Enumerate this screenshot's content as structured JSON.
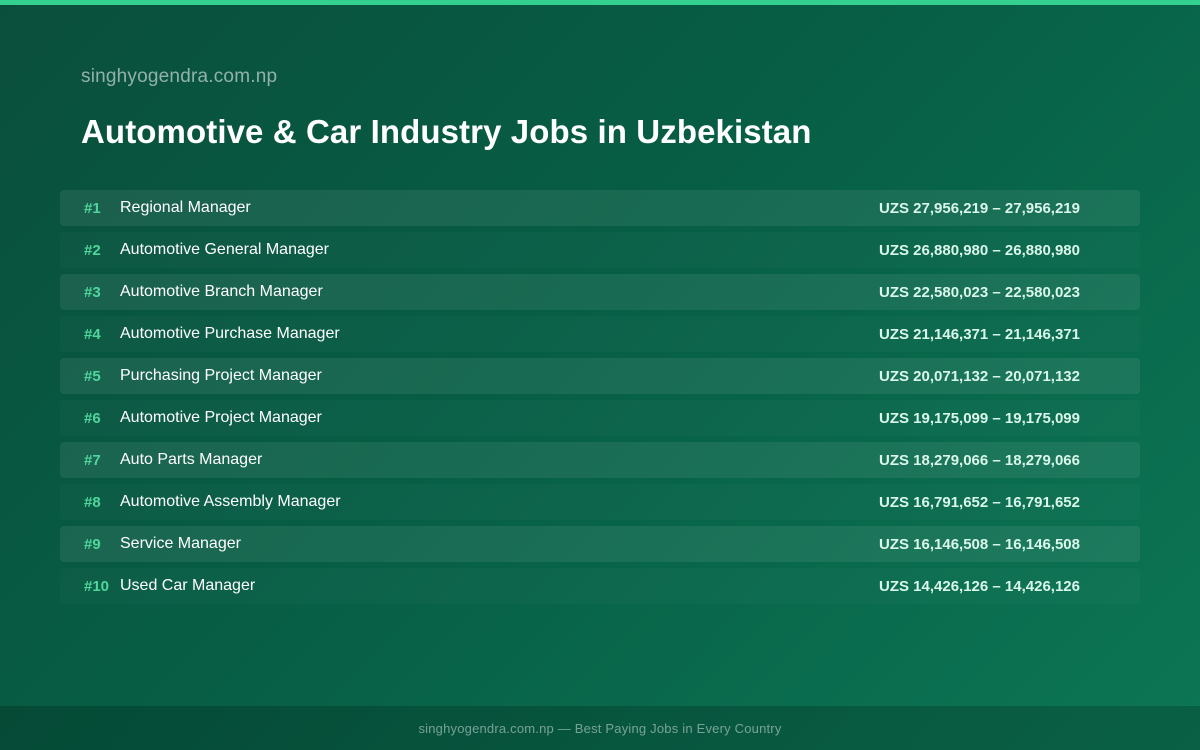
{
  "header": {
    "site_name": "singhyogendra.com.np",
    "title": "Automotive & Car Industry Jobs in Uzbekistan"
  },
  "jobs": [
    {
      "rank": "#1",
      "title": "Regional Manager",
      "salary": "UZS 27,956,219 – 27,956,219"
    },
    {
      "rank": "#2",
      "title": "Automotive General Manager",
      "salary": "UZS 26,880,980 – 26,880,980"
    },
    {
      "rank": "#3",
      "title": "Automotive Branch Manager",
      "salary": "UZS 22,580,023 – 22,580,023"
    },
    {
      "rank": "#4",
      "title": "Automotive Purchase Manager",
      "salary": "UZS 21,146,371 – 21,146,371"
    },
    {
      "rank": "#5",
      "title": "Purchasing Project Manager",
      "salary": "UZS 20,071,132 – 20,071,132"
    },
    {
      "rank": "#6",
      "title": "Automotive Project Manager",
      "salary": "UZS 19,175,099 – 19,175,099"
    },
    {
      "rank": "#7",
      "title": "Auto Parts Manager",
      "salary": "UZS 18,279,066 – 18,279,066"
    },
    {
      "rank": "#8",
      "title": "Automotive Assembly Manager",
      "salary": "UZS 16,791,652 – 16,791,652"
    },
    {
      "rank": "#9",
      "title": "Service Manager",
      "salary": "UZS 16,146,508 – 16,146,508"
    },
    {
      "rank": "#10",
      "title": "Used Car Manager",
      "salary": "UZS 14,426,126 – 14,426,126"
    }
  ],
  "footer": {
    "text": "singhyogendra.com.np — Best Paying Jobs in Every Country"
  },
  "colors": {
    "accent": "#34d08f",
    "rank": "#4fd69c",
    "background_start": "#0a4f3c",
    "background_end": "#0c7654"
  }
}
